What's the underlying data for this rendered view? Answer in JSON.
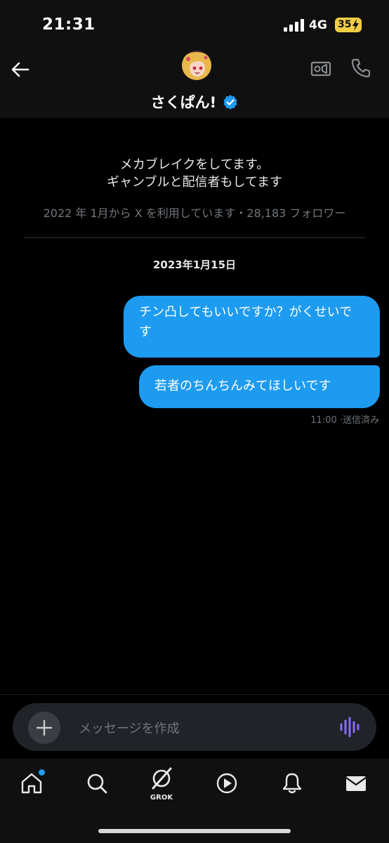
{
  "status_bar": {
    "time": "21:31",
    "network": "4G",
    "battery": "35"
  },
  "header": {
    "name": "さくぱん!",
    "verified": true,
    "icons": [
      "back-arrow-icon",
      "video-call-icon",
      "phone-icon"
    ]
  },
  "profile": {
    "bio_line1": "メカブレイクをしてます。",
    "bio_line2": "ギャンブルと配信者もしてます",
    "meta": "2022 年 1月から X を利用しています・28,183 フォロワー"
  },
  "conversation": {
    "date": "2023年1月15日",
    "messages": [
      {
        "text": "チン凸してもいいですか？がくせいです",
        "sender": "me"
      },
      {
        "text": "若者のちんちんみてほしいです",
        "sender": "me"
      }
    ],
    "last_meta": "11:00 ·送信済み"
  },
  "composer": {
    "placeholder": "メッセージを作成"
  },
  "tabs": {
    "grok_label": "GROK",
    "items": [
      "home",
      "search",
      "grok",
      "video",
      "notifications",
      "messages"
    ],
    "active": "messages"
  },
  "colors": {
    "accent": "#1d9bf0",
    "voice": "#8a6df6",
    "battery": "#f2cd45"
  }
}
